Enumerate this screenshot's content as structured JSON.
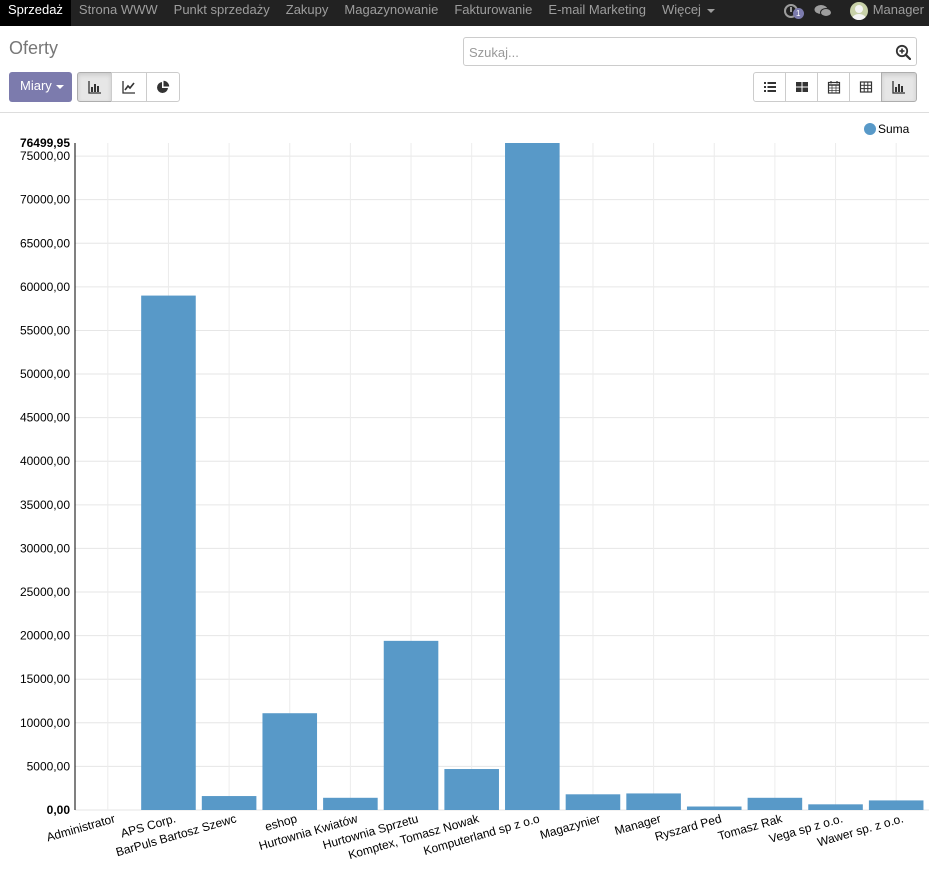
{
  "navbar": {
    "items": [
      {
        "label": "Sprzedaż",
        "active": true
      },
      {
        "label": "Strona WWW",
        "active": false
      },
      {
        "label": "Punkt sprzedaży",
        "active": false
      },
      {
        "label": "Zakupy",
        "active": false
      },
      {
        "label": "Magazynowanie",
        "active": false
      },
      {
        "label": "Fakturowanie",
        "active": false
      },
      {
        "label": "E-mail Marketing",
        "active": false
      }
    ],
    "more_label": "Więcej",
    "activity_badge": "1",
    "user_name": "Manager"
  },
  "control_panel": {
    "title": "Oferty",
    "search_placeholder": "Szukaj...",
    "measures_label": "Miary",
    "chart_type_icons": [
      "bar-chart-icon",
      "line-chart-icon",
      "pie-chart-icon"
    ],
    "active_chart_type": "bar",
    "view_icons": [
      "list-view-icon",
      "kanban-view-icon",
      "calendar-view-icon",
      "pivot-view-icon",
      "graph-view-icon"
    ],
    "active_view": "graph",
    "accent_color": "#7c7bad"
  },
  "chart_data": {
    "type": "bar",
    "categories": [
      "Administrator",
      "APS Corp.",
      "BarPuls Bartosz Szewc",
      "eshop",
      "Hurtownia Kwiatów",
      "Hurtownia Sprzetu",
      "Komptex, Tomasz Nowak",
      "Komputerland sp z o.o",
      "Magazynier",
      "Manager",
      "Ryszard Ped",
      "Tomasz Rak",
      "Vega sp z o.o.",
      "Wawer sp. z o.o."
    ],
    "series": [
      {
        "name": "Suma",
        "color": "#5899c8",
        "values": [
          0,
          59000,
          1600,
          11100,
          1400,
          19400,
          4700,
          76499.95,
          1800,
          1900,
          400,
          1400,
          650,
          1100
        ]
      }
    ],
    "ylim": [
      0,
      76499.95
    ],
    "y_ticks": [
      "0,00",
      "5000,00",
      "10000,00",
      "15000,00",
      "20000,00",
      "25000,00",
      "30000,00",
      "35000,00",
      "40000,00",
      "45000,00",
      "50000,00",
      "55000,00",
      "60000,00",
      "65000,00",
      "70000,00",
      "75000,00"
    ],
    "y_max_label": "76499,95",
    "legend": "top-right",
    "grid": true
  }
}
